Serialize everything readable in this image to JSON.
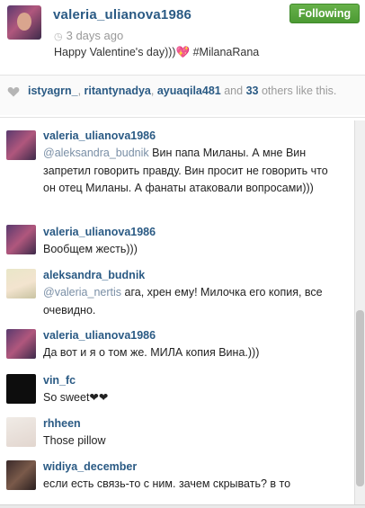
{
  "post": {
    "username": "valeria_ulianova1986",
    "time_ago": "3 days ago",
    "caption": "Happy Valentine's day)))💖 #MilanaRana",
    "follow_button": "Following"
  },
  "likes": {
    "users": [
      "istyagrn_",
      "ritantynadya",
      "ayuaqila481"
    ],
    "and_text": "and",
    "others_count": "33",
    "others_text": "others like this."
  },
  "comments": [
    {
      "username": "valeria_ulianova1986",
      "mention": "@aleksandra_budnik",
      "text": "Вин папа Миланы. А мне Вин запретил говорить правду. Вин просит не говорить что он отец Миланы. А фанаты атаковали вопросами)))"
    },
    {
      "username": "valeria_ulianova1986",
      "mention": "",
      "text": "Вообщем жесть)))"
    },
    {
      "username": "aleksandra_budnik",
      "mention": "@valeria_nertis",
      "text": "ага, хрен ему! Милочка его копия, все очевидно."
    },
    {
      "username": "valeria_ulianova1986",
      "mention": "",
      "text": "Да вот и я о том же. МИЛА копия Вина.)))"
    },
    {
      "username": "vin_fc",
      "mention": "",
      "text": "So sweet❤❤"
    },
    {
      "username": "rhheen",
      "mention": "",
      "text": "Those pillow"
    },
    {
      "username": "widiya_december",
      "mention": "",
      "text": "если есть связь-то с ним. зачем скрывать? в то"
    }
  ],
  "icons": {
    "clock": "clock-icon",
    "heart": "heart-icon"
  },
  "colors": {
    "link": "#2a5a84",
    "follow_green": "#4c9a33",
    "muted": "#999999"
  }
}
